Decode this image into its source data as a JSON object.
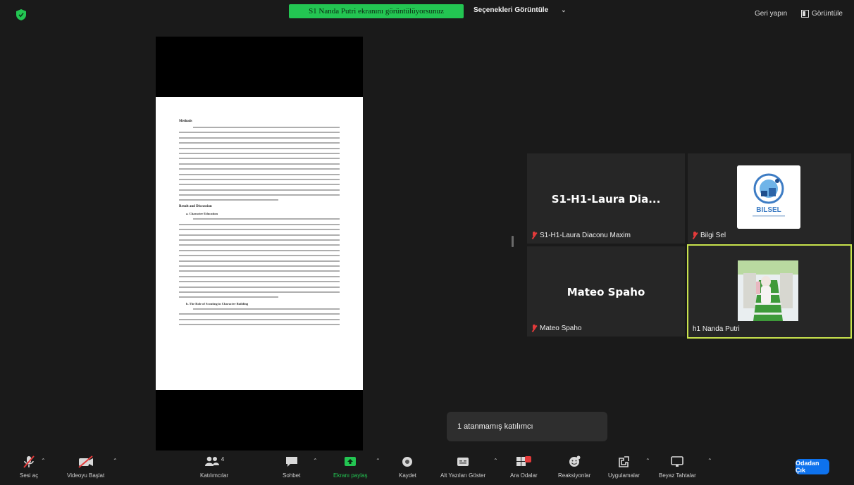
{
  "top_bar": {
    "share_banner": "S1 Nanda Putri ekranını görüntülüyorsunuz",
    "view_options": "Seçenekleri Görüntüle",
    "fullscreen": "Geri yapın",
    "view": "Görüntüle"
  },
  "document": {
    "headings": [
      "Methods",
      "Result and Discussion"
    ],
    "subheadings": [
      "a. Character Education",
      "b. The Role of Scouting in Character Building"
    ]
  },
  "participants": [
    {
      "display_name": "S1-H1-Laura  Dia...",
      "label": "S1-H1-Laura Diaconu Maxim",
      "muted": true
    },
    {
      "label": "Bilgi Sel",
      "muted": true,
      "avatar": "bilsel-logo"
    },
    {
      "display_name": "Mateo Spaho",
      "label": "Mateo Spaho",
      "muted": true
    },
    {
      "label": "h1 Nanda Putri",
      "muted": false,
      "active_speaker": true
    }
  ],
  "bilsel_logo_text": "BILSEL",
  "notification": "1 atanmamış katılımcı",
  "toolbar": {
    "mute": "Sesi aç",
    "video": "Videoyu Başlat",
    "participants": "Katılımcılar",
    "participant_count": "4",
    "chat": "Sohbet",
    "share": "Ekranı paylaş",
    "record": "Kaydet",
    "captions": "Alt Yazıları Göster",
    "breakout": "Ara Odalar",
    "reactions": "Reaksiyonlar",
    "apps": "Uygulamalar",
    "whiteboard": "Beyaz Tahtalar",
    "leave": "Odadan Çık"
  },
  "colors": {
    "share_green": "#23c552",
    "leave_blue": "#0e72ed",
    "active_border": "#c9e34d",
    "muted_red": "#e23a3a"
  }
}
